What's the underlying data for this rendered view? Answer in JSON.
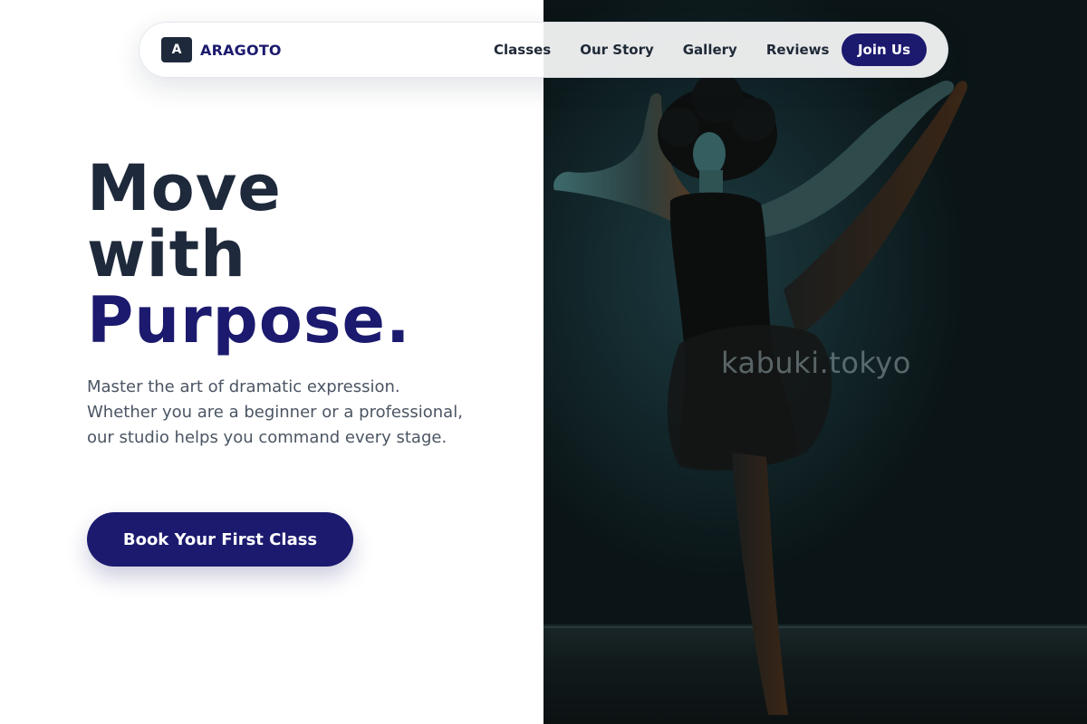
{
  "brand": {
    "mark": "A",
    "name": "ARAGOTO"
  },
  "nav": {
    "links": [
      "Classes",
      "Our Story",
      "Gallery",
      "Reviews"
    ],
    "cta_label": "Join Us"
  },
  "hero": {
    "title_line_1": "Move",
    "title_line_2": "with",
    "title_line_3": "Purpose.",
    "description": "Master the art of dramatic expression. Whether you are a beginner or a professional, our studio helps you command every stage.",
    "cta_label": "Book Your First Class"
  },
  "photo": {
    "watermark": "kabuki.tokyo",
    "subject": "dancer-photo"
  },
  "colors": {
    "accent": "#1c1a6e",
    "heading": "#1e293b",
    "body_text": "#4b5563",
    "photo_background": "#0b1517"
  }
}
